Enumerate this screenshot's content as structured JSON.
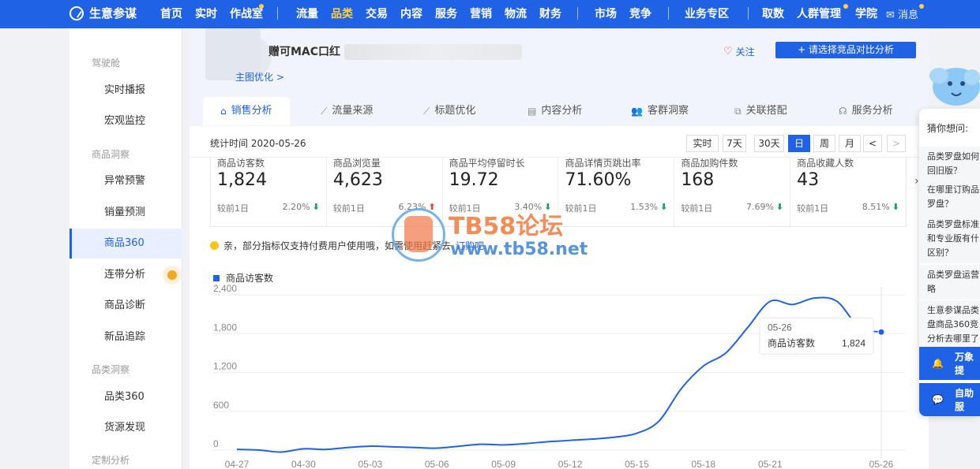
{
  "brand": {
    "name": "生意参谋"
  },
  "nav": {
    "items": [
      "首页",
      "实时",
      "作战室",
      "流量",
      "品类",
      "交易",
      "内容",
      "服务",
      "营销",
      "物流",
      "财务",
      "市场",
      "竞争",
      "业务专区",
      "取数",
      "人群管理",
      "学院"
    ],
    "active": "品类",
    "message": "消息"
  },
  "sidebar": {
    "groups": [
      "驾驶舱",
      "商品洞察",
      "品类洞察",
      "定制分析"
    ],
    "items": [
      "实时播报",
      "宏观监控",
      "异常预警",
      "销量预测",
      "商品360",
      "连带分析",
      "商品诊断",
      "新品追踪",
      "品类360",
      "货源发现"
    ],
    "active": "商品360"
  },
  "product": {
    "title": "赠可MAC口红",
    "optimize_link": "主图优化 >",
    "follow": "关注",
    "compare_button": "+ 请选择竞品对比分析"
  },
  "tabs": [
    "销售分析",
    "流量来源",
    "标题优化",
    "内容分析",
    "客群洞察",
    "关联搭配",
    "服务分析"
  ],
  "date": {
    "label": "统计时间 2020-05-26",
    "ranges": [
      "实时",
      "7天",
      "30天",
      "日",
      "周",
      "月"
    ],
    "active": "日",
    "prev": "<",
    "next": ">"
  },
  "metrics": [
    {
      "label": "商品访客数",
      "value": "1,824",
      "compare": "较前1日",
      "pct": "2.20%",
      "dir": "down"
    },
    {
      "label": "商品浏览量",
      "value": "4,623",
      "compare": "较前1日",
      "pct": "6.23%",
      "dir": "up"
    },
    {
      "label": "商品平均停留时长",
      "value": "19.72",
      "compare": "较前1日",
      "pct": "3.40%",
      "dir": "down"
    },
    {
      "label": "商品详情页跳出率",
      "value": "71.60%",
      "compare": "较前1日",
      "pct": "1.53%",
      "dir": "down"
    },
    {
      "label": "商品加购件数",
      "value": "168",
      "compare": "较前1日",
      "pct": "7.69%",
      "dir": "down"
    },
    {
      "label": "商品收藏人数",
      "value": "43",
      "compare": "较前1日",
      "pct": "8.51%",
      "dir": "down"
    }
  ],
  "notice": {
    "text": "亲，部分指标仅支持付费用户使用哦，如需使用赶紧去",
    "link": "订购吧"
  },
  "watermark": {
    "title": "TB58论坛",
    "url": "www.tb58.net"
  },
  "tooltip": {
    "date": "05-26",
    "label": "商品访客数",
    "value": "1,824"
  },
  "helper": {
    "title": "猜你想问:",
    "questions": [
      "品类罗盘如何",
      "回旧版？",
      "在哪里订购品",
      "罗盘？",
      "品类罗盘标准",
      "和专业版有什",
      "区别？",
      "品类罗盘运营",
      "略",
      "生意参谋品类",
      "盘商品360竞",
      "分析去哪里了"
    ],
    "buttons": [
      "万象提",
      "自助服"
    ]
  },
  "colors": {
    "primary": "#2062e6",
    "highlight": "#ffd23b",
    "down": "#19a15f",
    "up": "#e64545"
  },
  "chart_data": {
    "type": "line",
    "series": [
      {
        "name": "商品访客数",
        "x": [
          "04-27",
          "04-28",
          "04-29",
          "04-30",
          "05-01",
          "05-02",
          "05-03",
          "05-04",
          "05-05",
          "05-06",
          "05-07",
          "05-08",
          "05-09",
          "05-10",
          "05-11",
          "05-12",
          "05-13",
          "05-14",
          "05-15",
          "05-16",
          "05-17",
          "05-18",
          "05-19",
          "05-20",
          "05-21",
          "05-22",
          "05-23",
          "05-24",
          "05-25",
          "05-26"
        ],
        "values": [
          10,
          0,
          -30,
          20,
          10,
          40,
          60,
          50,
          40,
          30,
          60,
          90,
          80,
          100,
          130,
          150,
          170,
          200,
          260,
          450,
          950,
          1300,
          1500,
          1900,
          2300,
          2250,
          2350,
          2300,
          1900,
          1824
        ]
      }
    ],
    "x_ticks": [
      "04-27",
      "04-30",
      "05-03",
      "05-06",
      "05-09",
      "05-12",
      "05-15",
      "05-18",
      "05-21",
      "05-26"
    ],
    "y_ticks": [
      "0",
      "600",
      "1,200",
      "1,800",
      "2,400"
    ],
    "ylim": [
      0,
      2400
    ],
    "grid": true,
    "legend": "top-left"
  }
}
